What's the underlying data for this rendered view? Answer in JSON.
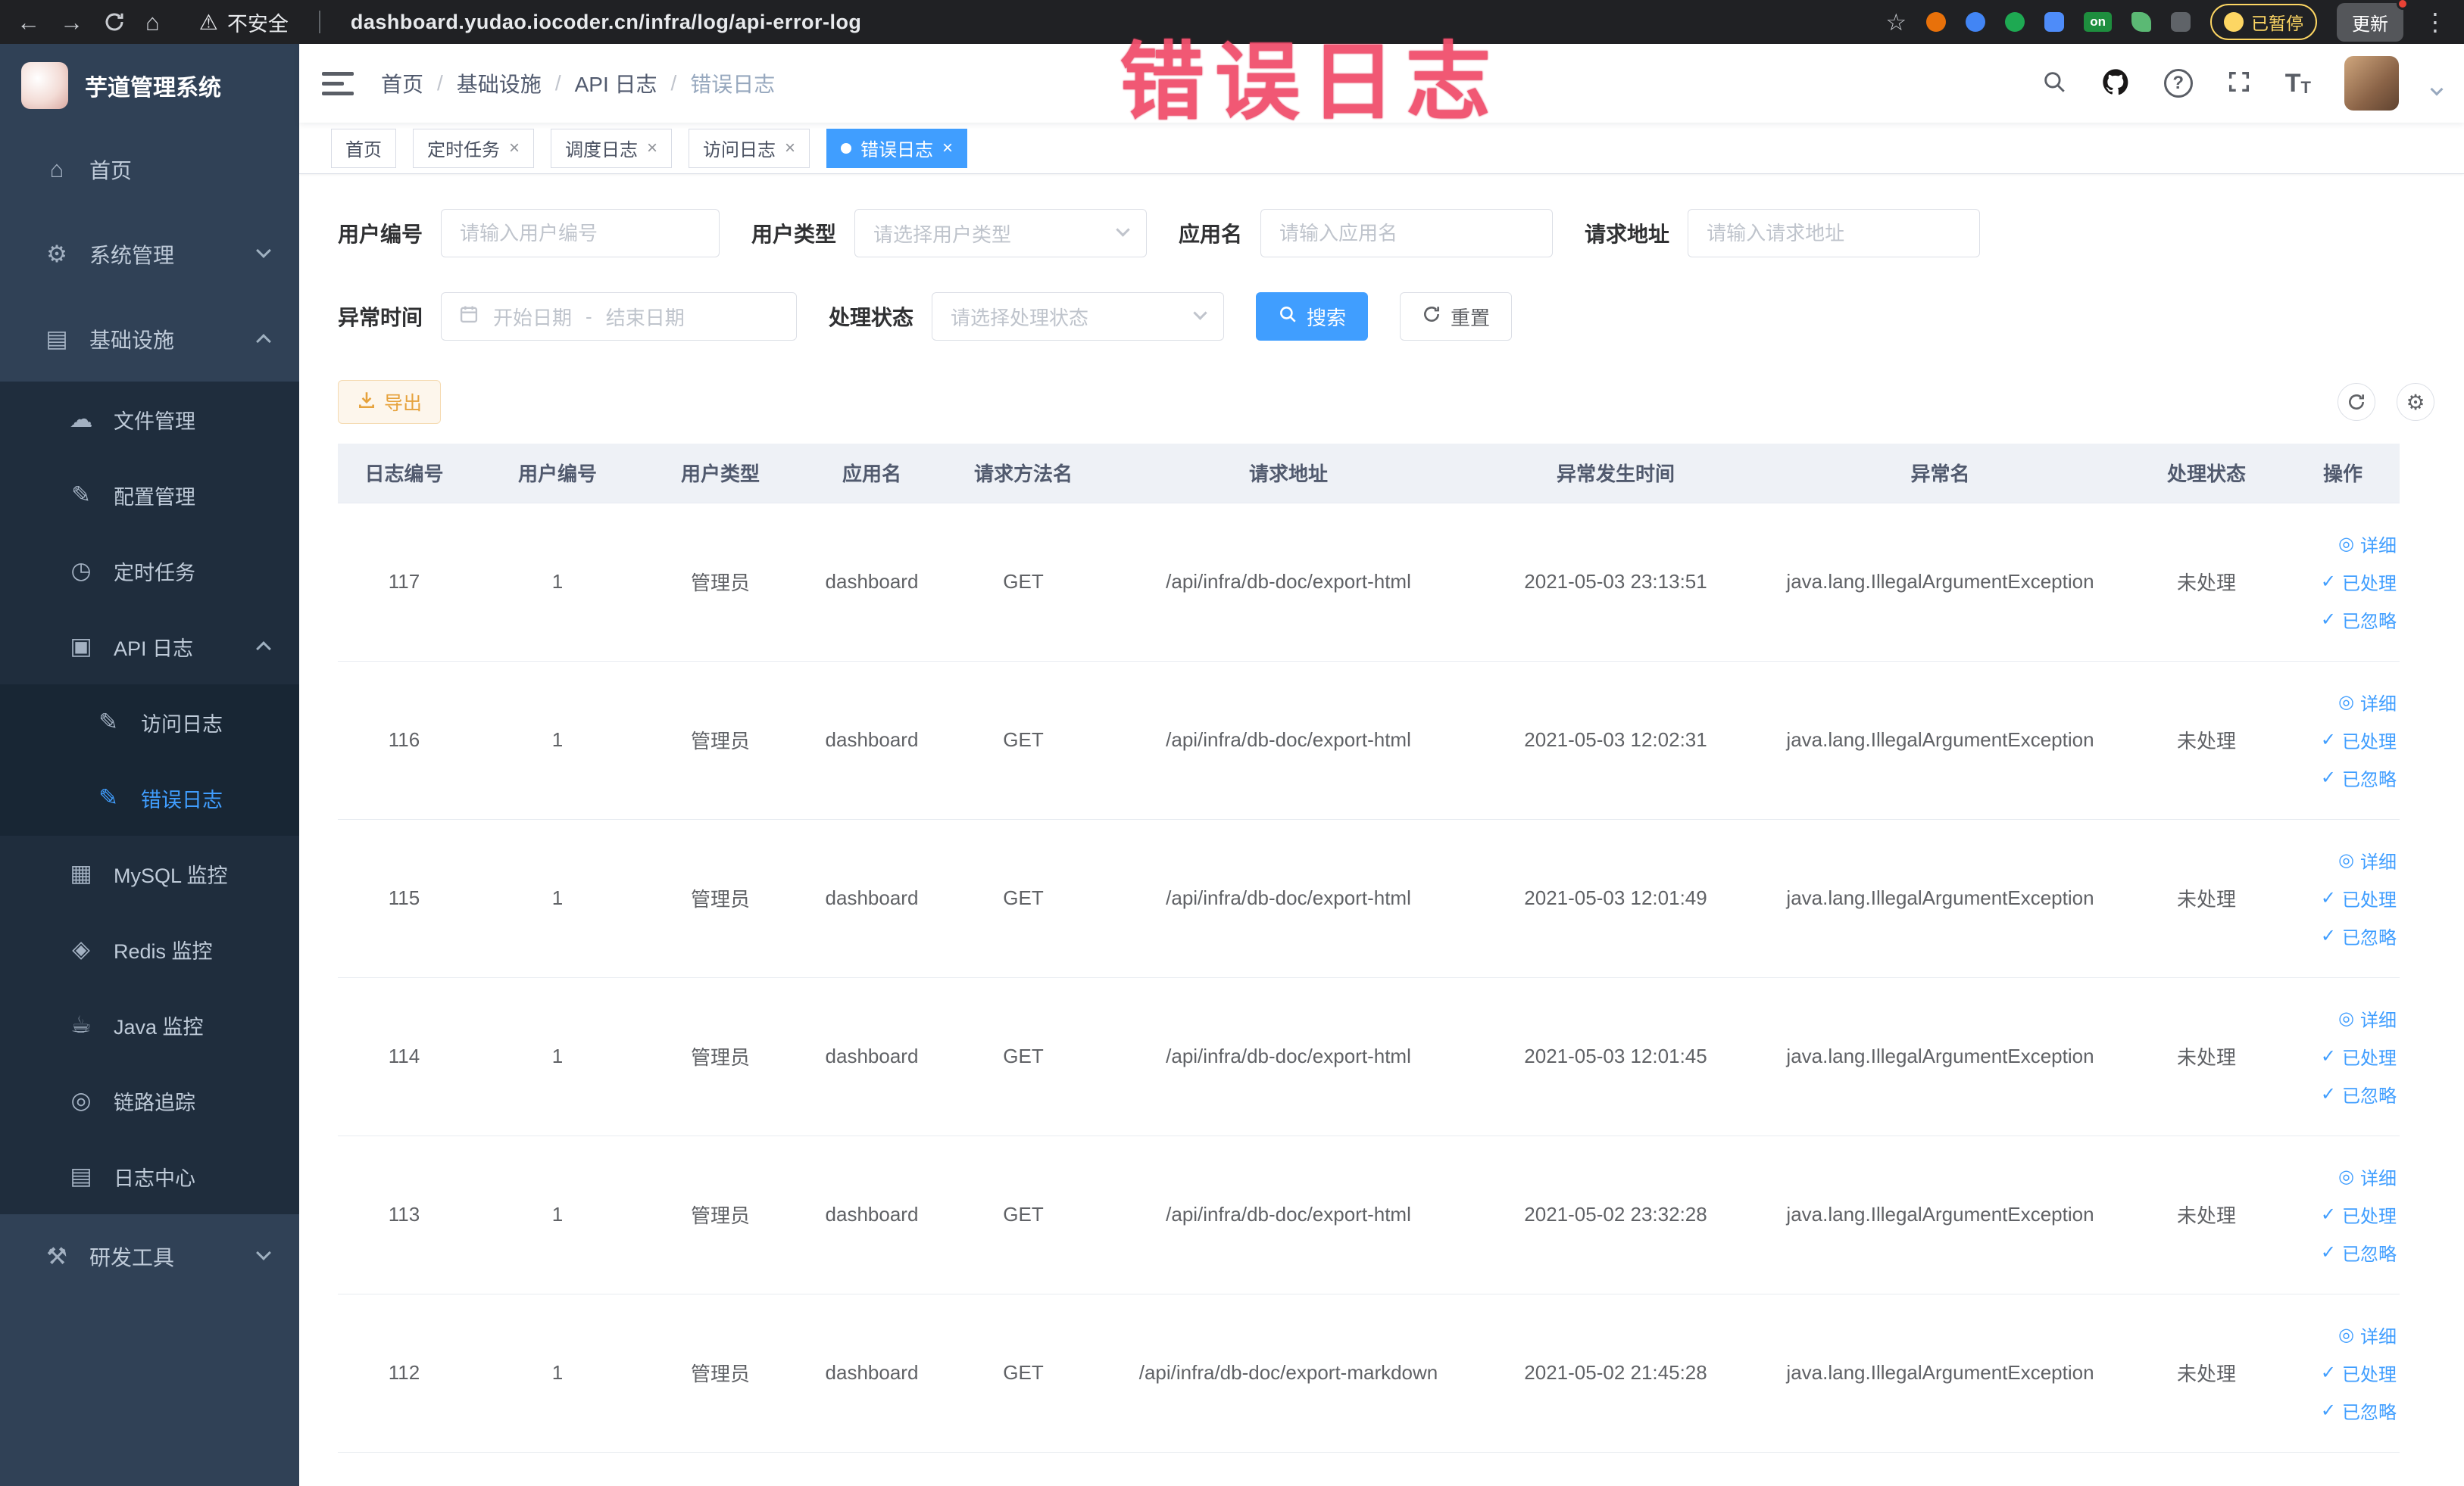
{
  "browser": {
    "security_label": "不安全",
    "url": "dashboard.yudao.iocoder.cn/infra/log/api-error-log",
    "on_badge": "on",
    "paused_badge": "已暂停",
    "update_label": "更新"
  },
  "watermark": "错误日志",
  "sidebar": {
    "logo_title": "芋道管理系统",
    "items": [
      {
        "label": "首页",
        "icon": "home-icon"
      },
      {
        "label": "系统管理",
        "icon": "gear-icon",
        "arrow": "down"
      },
      {
        "label": "基础设施",
        "icon": "infra-icon",
        "arrow": "up"
      },
      {
        "label": "文件管理",
        "icon": "file-icon"
      },
      {
        "label": "配置管理",
        "icon": "config-icon"
      },
      {
        "label": "定时任务",
        "icon": "timer-icon"
      },
      {
        "label": "API 日志",
        "icon": "api-log-icon",
        "arrow": "up"
      },
      {
        "label": "访问日志",
        "icon": "access-log-icon"
      },
      {
        "label": "错误日志",
        "icon": "error-log-icon",
        "active": true
      },
      {
        "label": "MySQL 监控",
        "icon": "mysql-icon"
      },
      {
        "label": "Redis 监控",
        "icon": "redis-icon"
      },
      {
        "label": "Java 监控",
        "icon": "java-icon"
      },
      {
        "label": "链路追踪",
        "icon": "trace-icon"
      },
      {
        "label": "日志中心",
        "icon": "log-center-icon"
      },
      {
        "label": "研发工具",
        "icon": "tools-icon",
        "arrow": "down"
      }
    ]
  },
  "breadcrumb": [
    "首页",
    "基础设施",
    "API 日志",
    "错误日志"
  ],
  "tabs": [
    {
      "label": "首页"
    },
    {
      "label": "定时任务"
    },
    {
      "label": "调度日志"
    },
    {
      "label": "访问日志"
    },
    {
      "label": "错误日志"
    }
  ],
  "filters": {
    "user_id": {
      "label": "用户编号",
      "placeholder": "请输入用户编号"
    },
    "user_type": {
      "label": "用户类型",
      "placeholder": "请选择用户类型"
    },
    "app_name": {
      "label": "应用名",
      "placeholder": "请输入应用名"
    },
    "request_url": {
      "label": "请求地址",
      "placeholder": "请输入请求地址"
    },
    "exception_time": {
      "label": "异常时间",
      "start_placeholder": "开始日期",
      "separator": "-",
      "end_placeholder": "结束日期"
    },
    "process_status": {
      "label": "处理状态",
      "placeholder": "请选择处理状态"
    },
    "search_label": "搜索",
    "reset_label": "重置"
  },
  "toolbar": {
    "export_label": "导出"
  },
  "table": {
    "columns": [
      "日志编号",
      "用户编号",
      "用户类型",
      "应用名",
      "请求方法名",
      "请求地址",
      "异常发生时间",
      "异常名",
      "处理状态",
      "操作"
    ],
    "actions": {
      "detail": "详细",
      "processed": "已处理",
      "ignored": "已忽略"
    },
    "rows": [
      {
        "id": "117",
        "user_id": "1",
        "user_type": "管理员",
        "app": "dashboard",
        "method": "GET",
        "url": "/api/infra/db-doc/export-html",
        "time": "2021-05-03 23:13:51",
        "exception": "java.lang.IllegalArgumentException",
        "status": "未处理"
      },
      {
        "id": "116",
        "user_id": "1",
        "user_type": "管理员",
        "app": "dashboard",
        "method": "GET",
        "url": "/api/infra/db-doc/export-html",
        "time": "2021-05-03 12:02:31",
        "exception": "java.lang.IllegalArgumentException",
        "status": "未处理"
      },
      {
        "id": "115",
        "user_id": "1",
        "user_type": "管理员",
        "app": "dashboard",
        "method": "GET",
        "url": "/api/infra/db-doc/export-html",
        "time": "2021-05-03 12:01:49",
        "exception": "java.lang.IllegalArgumentException",
        "status": "未处理"
      },
      {
        "id": "114",
        "user_id": "1",
        "user_type": "管理员",
        "app": "dashboard",
        "method": "GET",
        "url": "/api/infra/db-doc/export-html",
        "time": "2021-05-03 12:01:45",
        "exception": "java.lang.IllegalArgumentException",
        "status": "未处理"
      },
      {
        "id": "113",
        "user_id": "1",
        "user_type": "管理员",
        "app": "dashboard",
        "method": "GET",
        "url": "/api/infra/db-doc/export-html",
        "time": "2021-05-02 23:32:28",
        "exception": "java.lang.IllegalArgumentException",
        "status": "未处理"
      },
      {
        "id": "112",
        "user_id": "1",
        "user_type": "管理员",
        "app": "dashboard",
        "method": "GET",
        "url": "/api/infra/db-doc/export-markdown",
        "time": "2021-05-02 21:45:28",
        "exception": "java.lang.IllegalArgumentException",
        "status": "未处理"
      }
    ]
  }
}
